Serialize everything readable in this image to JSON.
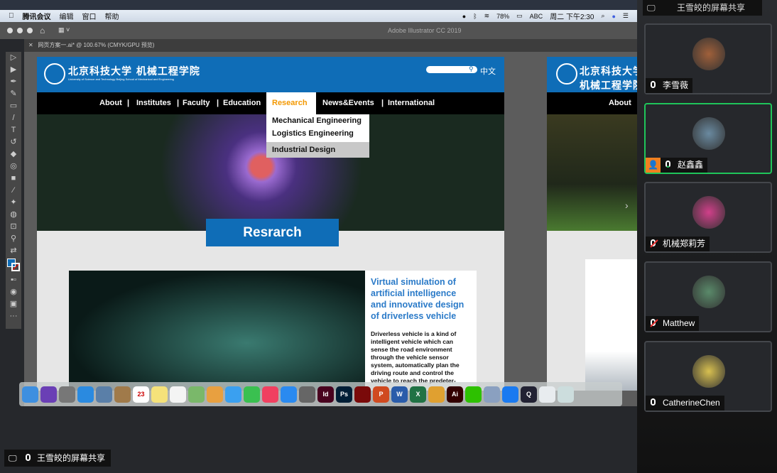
{
  "menubar": {
    "app": "腾讯会议",
    "items": [
      "编辑",
      "窗口",
      "帮助"
    ],
    "battery": "78%",
    "input": "ABC",
    "clock": "周二 下午2:30"
  },
  "illustrator": {
    "title": "Adobe Illustrator CC 2019",
    "doc_tab": "网页方案一.ai* @ 100.67% (CMYK/GPU 预览)"
  },
  "tools": [
    "selection",
    "direct-selection",
    "pen",
    "curvature",
    "rectangle",
    "paintbrush",
    "type",
    "rotate",
    "eraser",
    "shape-builder",
    "gradient",
    "eyedropper",
    "puppet-warp",
    "blend",
    "artboard",
    "zoom",
    "swap",
    "fill-stroke",
    "color-mode",
    "draw-mode",
    "screen-mode",
    "more"
  ],
  "site": {
    "name_cn": "北京科技大学 机械工程学院",
    "name_en": "University of Science and Technology Beijing   School of Mechanical and Engineering",
    "lang": "中文",
    "nav": [
      "About",
      "|",
      "Institutes",
      "|",
      "Faculty",
      "|",
      "Education",
      "Research",
      "News&Events",
      "|",
      "International"
    ],
    "dropdown": [
      "Mechanical Engineering",
      "Logistics Engineering",
      "Industrial Design"
    ],
    "section_title": "Resrarch",
    "card_title": "Virtual simulation of artificial intelligence and innovative design of driverless vehicle",
    "card_body": "Driverless vehicle is a kind of intelligent vehicle which can sense the road environment through the vehicle sensor system, automatically plan the driving route and control the vehicle to reach the predeter-",
    "accent": "#0f6db7",
    "highlight": "#f39800"
  },
  "artboard2": {
    "nav_first": "About"
  },
  "dock": [
    {
      "n": "finder",
      "c": "#3d8fe0",
      "t": ""
    },
    {
      "n": "siri",
      "c": "#6a3fb5",
      "t": ""
    },
    {
      "n": "launchpad",
      "c": "#777",
      "t": ""
    },
    {
      "n": "safari",
      "c": "#2a8ae0",
      "t": ""
    },
    {
      "n": "preview",
      "c": "#5a7fa8",
      "t": ""
    },
    {
      "n": "contacts",
      "c": "#a07a4a",
      "t": ""
    },
    {
      "n": "calendar",
      "c": "#fff",
      "t": "23"
    },
    {
      "n": "notes",
      "c": "#f5e27a",
      "t": ""
    },
    {
      "n": "reminders",
      "c": "#f4f4f4",
      "t": ""
    },
    {
      "n": "maps",
      "c": "#7ab86a",
      "t": ""
    },
    {
      "n": "photos",
      "c": "#e8a040",
      "t": ""
    },
    {
      "n": "messages",
      "c": "#3aa0f0",
      "t": ""
    },
    {
      "n": "facetime",
      "c": "#3ac050",
      "t": ""
    },
    {
      "n": "music",
      "c": "#f04060",
      "t": ""
    },
    {
      "n": "app-store",
      "c": "#2a8af0",
      "t": ""
    },
    {
      "n": "system-preferences",
      "c": "#666",
      "t": ""
    },
    {
      "n": "indesign",
      "c": "#49021f",
      "t": "Id"
    },
    {
      "n": "photoshop",
      "c": "#001e36",
      "t": "Ps"
    },
    {
      "n": "acrobat",
      "c": "#7a0a0a",
      "t": ""
    },
    {
      "n": "powerpoint",
      "c": "#d04a20",
      "t": "P"
    },
    {
      "n": "word",
      "c": "#2a5caa",
      "t": "W"
    },
    {
      "n": "excel",
      "c": "#207244",
      "t": "X"
    },
    {
      "n": "archiver",
      "c": "#e0a030",
      "t": ""
    },
    {
      "n": "illustrator",
      "c": "#330000",
      "t": "Ai"
    },
    {
      "n": "wechat",
      "c": "#2dc100",
      "t": ""
    },
    {
      "n": "image-capture",
      "c": "#8aa0c0",
      "t": ""
    },
    {
      "n": "tencent-meeting",
      "c": "#1a7af0",
      "t": ""
    },
    {
      "n": "quicktime",
      "c": "#223",
      "t": "Q"
    },
    {
      "n": "downloads",
      "c": "#e8ecef",
      "t": ""
    },
    {
      "n": "trash",
      "c": "#cdd",
      "t": ""
    }
  ],
  "meeting": {
    "share_label": "王雪皎的屏幕共享",
    "participants": [
      {
        "name": "李雪薇",
        "muted": false,
        "active": false,
        "avatar": "#a0603a"
      },
      {
        "name": "赵鑫鑫",
        "muted": false,
        "active": true,
        "host": true,
        "avatar": "#6a8aa0"
      },
      {
        "name": "机械郑莉芳",
        "muted": true,
        "active": false,
        "avatar": "#d0408a"
      },
      {
        "name": "Matthew",
        "muted": true,
        "active": false,
        "avatar": "#5a8a6a"
      },
      {
        "name": "CatherineChen",
        "muted": false,
        "active": false,
        "avatar": "#d8c050"
      }
    ],
    "speaking_color": "#1fc55a",
    "host_color": "#f08020"
  }
}
